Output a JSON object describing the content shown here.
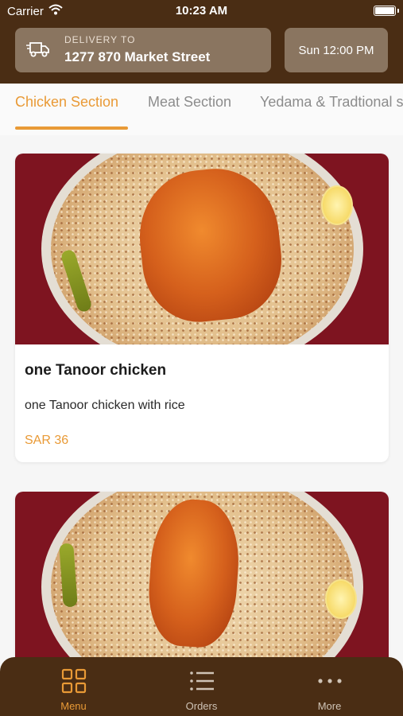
{
  "status": {
    "carrier": "Carrier",
    "time": "10:23 AM"
  },
  "delivery": {
    "label": "DELIVERY TO",
    "address": "1277 870 Market Street"
  },
  "schedule": {
    "time": "Sun 12:00 PM"
  },
  "tabs": [
    {
      "label": "Chicken Section",
      "active": true
    },
    {
      "label": "Meat Section",
      "active": false
    },
    {
      "label": "Yedama & Tradtional s",
      "active": false
    }
  ],
  "items": [
    {
      "title": "one Tanoor chicken",
      "description": "one Tanoor chicken with rice",
      "price": "SAR 36"
    }
  ],
  "nav": [
    {
      "label": "Menu",
      "icon": "grid-icon",
      "active": true
    },
    {
      "label": "Orders",
      "icon": "list-icon",
      "active": false
    },
    {
      "label": "More",
      "icon": "more-dots-icon",
      "active": false
    }
  ],
  "colors": {
    "brand_brown": "#4a2d14",
    "accent_orange": "#e99a36",
    "header_box": "#8a7560"
  }
}
